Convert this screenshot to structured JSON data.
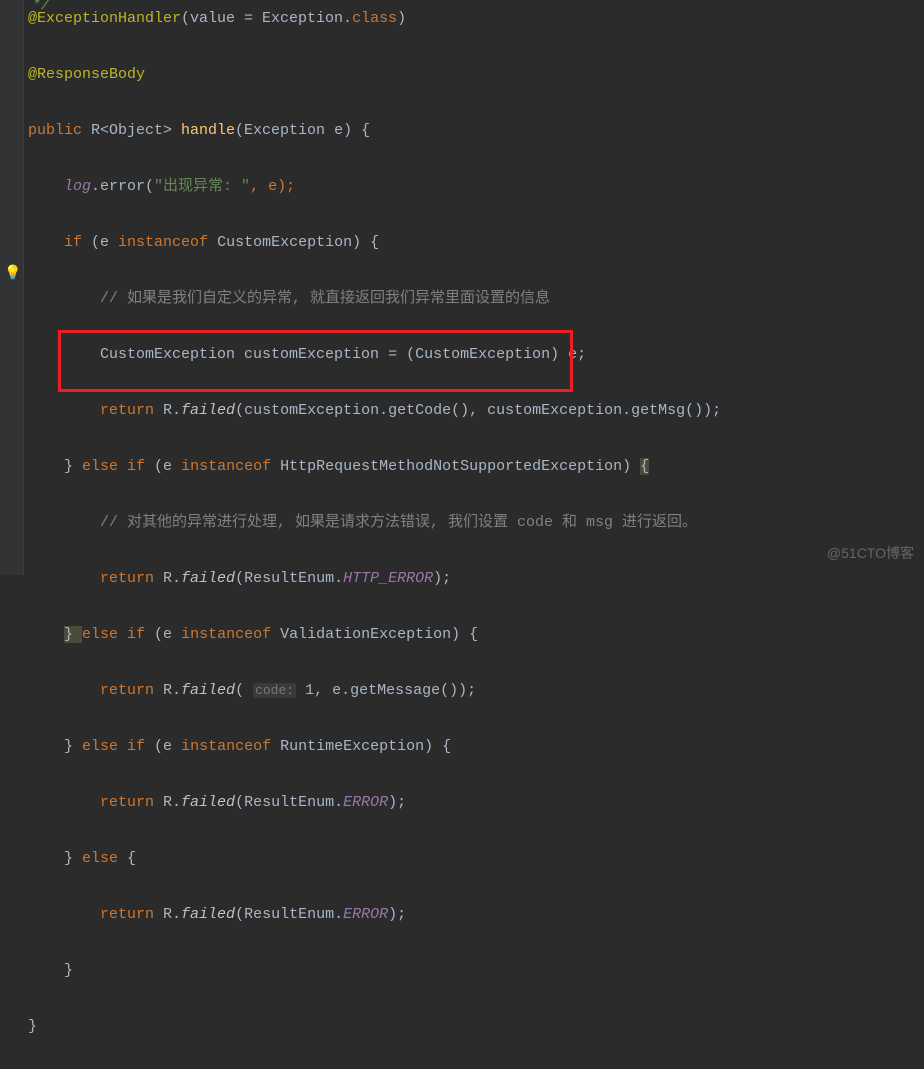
{
  "code": {
    "l0": "*/",
    "l1_anno": "@ExceptionHandler",
    "l1_rest1": "(value = Exception.",
    "l1_class": "class",
    "l1_rest2": ")",
    "l2_anno": "@ResponseBody",
    "l3_kw": "public ",
    "l3_type": "R<Object> ",
    "l3_method": "handle",
    "l3_rest": "(Exception e) {",
    "l4_field": "log",
    "l4_rest1": ".error(",
    "l4_str": "\"出现异常: \"",
    "l4_rest2": ", e);",
    "l5_kw1": "if ",
    "l5_rest1": "(e ",
    "l5_kw2": "instanceof ",
    "l5_rest2": "CustomException) {",
    "l6_comment": "// 如果是我们自定义的异常, 就直接返回我们异常里面设置的信息",
    "l7": "CustomException customException = (CustomException) e;",
    "l8_kw": "return ",
    "l8_cls": "R.",
    "l8_m": "failed",
    "l8_rest": "(customException.getCode(), customException.getMsg());",
    "l9_rest1": "} ",
    "l9_kw1": "else if ",
    "l9_rest2": "(e ",
    "l9_kw2": "instanceof ",
    "l9_rest3": "HttpRequestMethodNotSupportedException) ",
    "l9_brace": "{",
    "l10_comment": "// 对其他的异常进行处理, 如果是请求方法错误, 我们设置 code 和 msg 进行返回。",
    "l11_kw": "return ",
    "l11_cls": "R.",
    "l11_m": "failed",
    "l11_rest1": "(ResultEnum.",
    "l11_enum": "HTTP_ERROR",
    "l11_rest2": ");",
    "l12_rest1": "} ",
    "l12_kw1": "else if ",
    "l12_rest2": "(e ",
    "l12_kw2": "instanceof ",
    "l12_rest3": "ValidationException) {",
    "l13_kw": "return ",
    "l13_cls": "R.",
    "l13_m": "failed",
    "l13_rest1": "( ",
    "l13_hint": "code:",
    "l13_rest2": " 1, e.getMessage());",
    "l14_rest1": "} ",
    "l14_kw1": "else if ",
    "l14_rest2": "(e ",
    "l14_kw2": "instanceof ",
    "l14_rest3": "RuntimeException) {",
    "l15_kw": "return ",
    "l15_cls": "R.",
    "l15_m": "failed",
    "l15_rest1": "(ResultEnum.",
    "l15_enum": "ERROR",
    "l15_rest2": ");",
    "l16_rest1": "} ",
    "l16_kw": "else ",
    "l16_rest2": "{",
    "l17_kw": "return ",
    "l17_cls": "R.",
    "l17_m": "failed",
    "l17_rest1": "(ResultEnum.",
    "l17_enum": "ERROR",
    "l17_rest2": ");",
    "l18": "}",
    "l19": "}"
  },
  "watermark": "@51CTO博客"
}
